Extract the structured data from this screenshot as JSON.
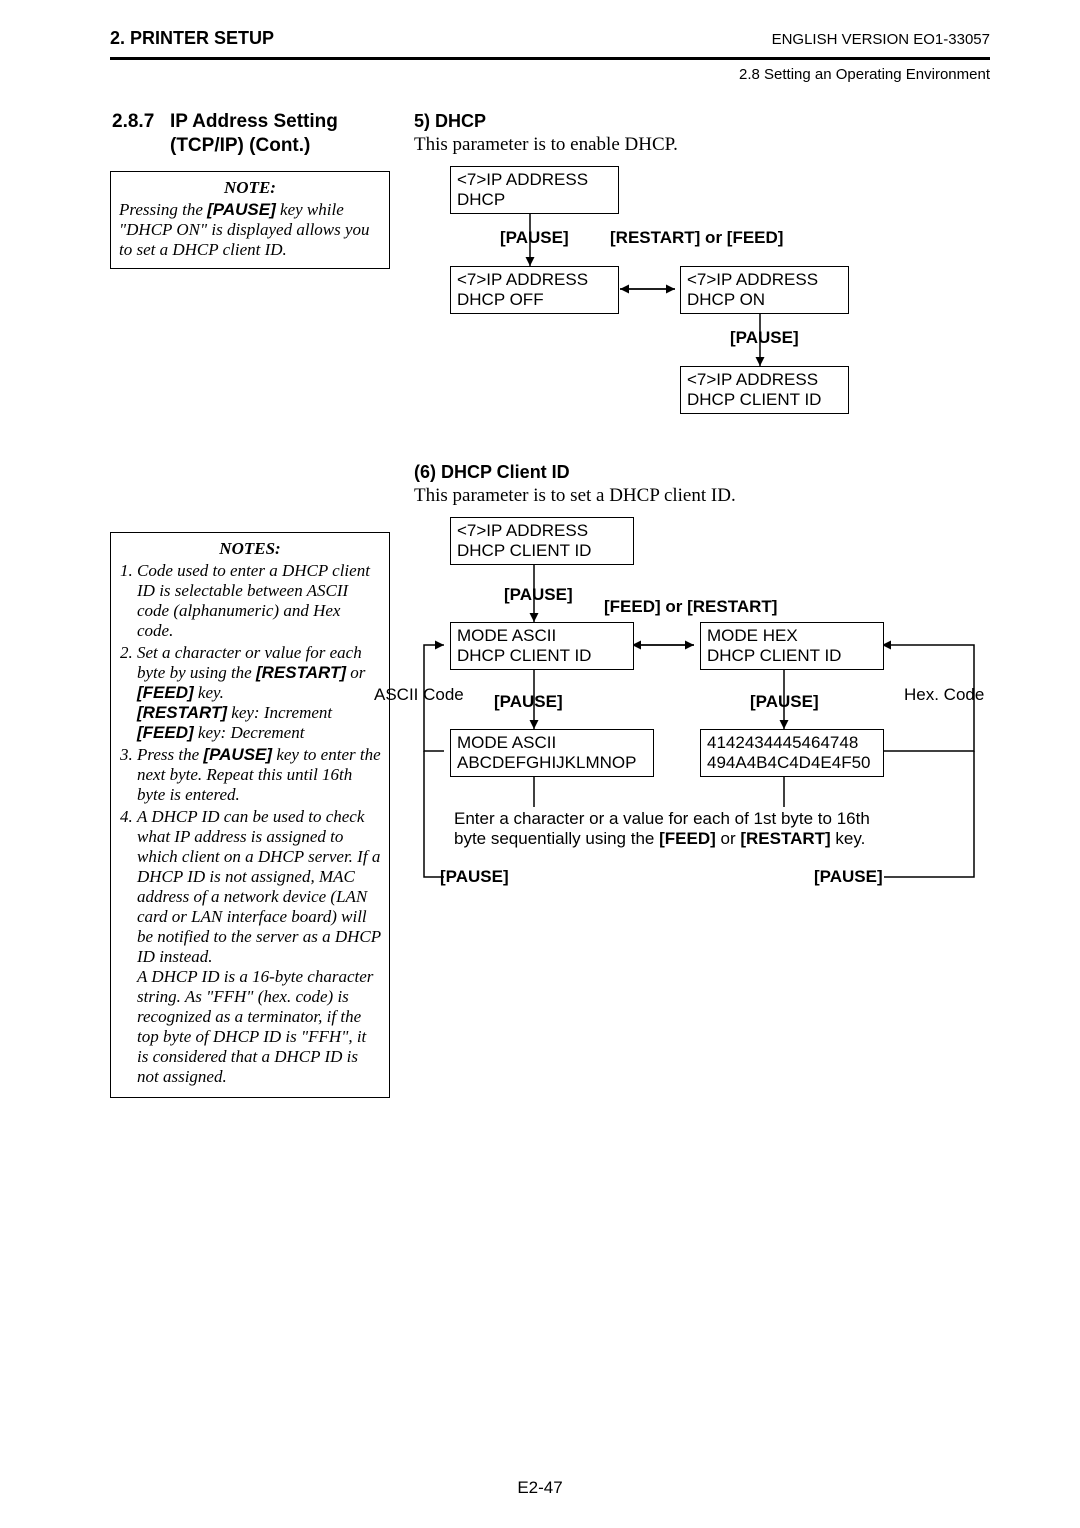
{
  "header": {
    "left": "2. PRINTER SETUP",
    "right_top": "ENGLISH VERSION EO1-33057",
    "right_sub": "2.8 Setting an Operating Environment"
  },
  "left": {
    "sect_num": "2.8.7",
    "sect_title": "IP Address Setting",
    "sect_sub": "(TCP/IP) (Cont.)",
    "note1_title": "NOTE:",
    "note1_body_a": "Pressing the ",
    "note1_body_b": "[PAUSE]",
    "note1_body_c": " key while \"DHCP ON\" is displayed allows you to set a DHCP client ID.",
    "notes_title": "NOTES:",
    "n1": "Code used to enter a DHCP client ID is selectable between ASCII code (alphanumeric) and Hex code.",
    "n2a": "Set a character or value for each byte by using the ",
    "n2_restart": "[RESTART]",
    "n2_or": " or ",
    "n2_feed": "[FEED]",
    "n2b": " key.",
    "n2c": " key: Increment",
    "n2d": " key: Decrement",
    "n3a": "Press the ",
    "n3b": " key to enter the next byte.  Repeat this until 16th byte is entered.",
    "n4": "A DHCP ID can be used to check what IP address is assigned to which client on a DHCP server.  If a DHCP ID is not assigned, MAC address of a network device (LAN card or LAN interface board) will be notified to the server as a DHCP ID instead.\nA DHCP ID is a 16-byte character string.  As \"FFH\" (hex. code) is recognized as a terminator, if the top byte of DHCP ID is \"FFH\", it is considered that a DHCP ID is not assigned."
  },
  "right": {
    "h5_1": "5)   DHCP",
    "p1": "This parameter is to enable DHCP.",
    "h5_2": "(6)  DHCP Client ID",
    "p2": "This parameter is to set a DHCP client ID.",
    "d1": {
      "b1l1": "<7>IP ADDRESS",
      "b1l2": "DHCP",
      "pause1": "[PAUSE]",
      "restfeed": "[RESTART] or [FEED]",
      "b2l1": "<7>IP ADDRESS",
      "b2l2": "DHCP     OFF",
      "b3l1": "<7>IP ADDRESS",
      "b3l2": "DHCP     ON",
      "pause2": "[PAUSE]",
      "b4l1": "<7>IP ADDRESS",
      "b4l2": "DHCP CLIENT ID"
    },
    "d2": {
      "b1l1": "<7>IP ADDRESS",
      "b1l2": "DHCP CLIENT ID",
      "pause1": "[PAUSE]",
      "feedrest": "[FEED] or [RESTART]",
      "b2l1": "MODE      ASCII",
      "b2l2": "DHCP CLIENT ID",
      "b3l1": "MODE      HEX",
      "b3l2": "DHCP CLIENT ID",
      "ascii": "ASCII Code",
      "hex": "Hex. Code",
      "pause2l": "[PAUSE]",
      "pause2r": "[PAUSE]",
      "b4l1": "MODE        ASCII",
      "b4l2": "ABCDEFGHIJKLMNOP",
      "b5l1": "4142434445464748",
      "b5l2": "494A4B4C4D4E4F50",
      "enter_a": "Enter a character or a value for each of 1st byte to 16th",
      "enter_b": "byte sequentially using the ",
      "enter_c": "[FEED]",
      "enter_d": " or ",
      "enter_e": "[RESTART]",
      "enter_f": " key.",
      "pause3l": "[PAUSE]",
      "pause3r": "[PAUSE]"
    }
  },
  "pagenum": "E2-47"
}
